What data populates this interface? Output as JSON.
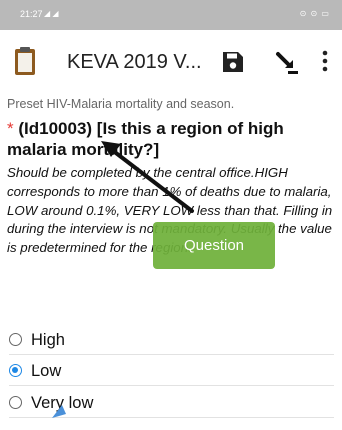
{
  "status_bar": {
    "time": "21:27",
    "signal": "◢ ◢",
    "icons": "⊙ ⊙ ▭"
  },
  "app_bar": {
    "title": "KEVA 2019 V...",
    "icons": [
      "clipboard-icon",
      "save-icon",
      "pin-icon",
      "more-vert-icon"
    ]
  },
  "subtitle": "Preset HIV-Malaria mortality and season.",
  "question": {
    "required_marker": "*",
    "text": "(Id10003) [Is this a region of high malaria mortality?]"
  },
  "hint": "Should be completed by the central office.HIGH corresponds to more than 1% of deaths due to malaria, LOW around 0.1%, VERY LOW less than that. Filling in during the interview is not mandatory. Usually the value is predetermined for the region.",
  "options": [
    {
      "label": "High",
      "checked": false
    },
    {
      "label": "Low",
      "checked": true
    },
    {
      "label": "Very low",
      "checked": false
    }
  ],
  "tooltip": {
    "label": "Question"
  },
  "colors": {
    "status_bar": "#b9b9b9",
    "required": "#e53935",
    "accent": "#1e88e5",
    "tooltip": "#6fb03a"
  }
}
